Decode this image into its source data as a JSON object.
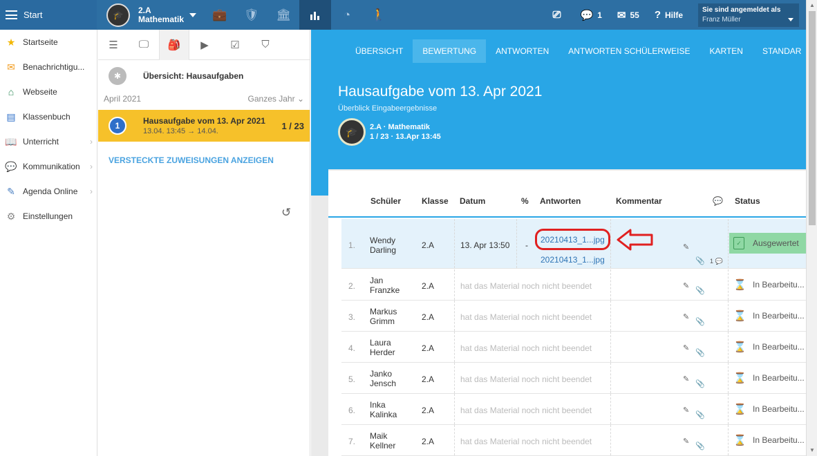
{
  "topbar": {
    "start_label": "Start",
    "class_line1": "2.A",
    "class_line2": "Mathematik",
    "messages_count": "1",
    "mail_count": "55",
    "help_label": "Hilfe",
    "login_label": "Sie sind angemeldet als",
    "login_user": "Franz Müller"
  },
  "sidebar": {
    "items": [
      {
        "label": "Startseite"
      },
      {
        "label": "Benachrichtigu..."
      },
      {
        "label": "Webseite"
      },
      {
        "label": "Klassenbuch"
      },
      {
        "label": "Unterricht"
      },
      {
        "label": "Kommunikation"
      },
      {
        "label": "Agenda Online"
      },
      {
        "label": "Einstellungen"
      }
    ]
  },
  "midpanel": {
    "overview_title": "Übersicht: Hausaufgaben",
    "period_label": "April 2021",
    "period_filter": "Ganzes Jahr",
    "assignment": {
      "number": "1",
      "title": "Hausaufgabe vom 13. Apr 2021",
      "dates": "13.04. 13:45 → 14.04.",
      "count": "1 / 23"
    },
    "hidden_link": "VERSTECKTE ZUWEISUNGEN ANZEIGEN"
  },
  "main": {
    "tabs": [
      {
        "label": "ÜBERSICHT"
      },
      {
        "label": "BEWERTUNG"
      },
      {
        "label": "ANTWORTEN"
      },
      {
        "label": "ANTWORTEN SCHÜLERWEISE"
      },
      {
        "label": "KARTEN"
      },
      {
        "label": "STANDAR"
      }
    ],
    "title": "Hausaufgabe vom 13. Apr 2021",
    "subtitle": "Überblick Eingabeergebnisse",
    "class_name": "2.A · Mathematik",
    "class_meta": "1 / 23 · 13.Apr 13:45"
  },
  "table": {
    "headers": {
      "student": "Schüler",
      "class": "Klasse",
      "date": "Datum",
      "percent": "%",
      "answers": "Antworten",
      "comment": "Kommentar",
      "status": "Status"
    },
    "selected_row": {
      "num": "1.",
      "name_line1": "Wendy",
      "name_line2": "Darling",
      "class": "2.A",
      "date": "13. Apr 13:50",
      "percent": "-",
      "file1": "20210413_1...jpg",
      "file2": "20210413_1...jpg",
      "comment_count": "1",
      "status": "Ausgewertet"
    },
    "rows": [
      {
        "num": "2.",
        "name_line1": "Jan",
        "name_line2": "Franzke",
        "class": "2.A",
        "msg": "hat das Material noch nicht beendet",
        "status": "In Bearbeitu..."
      },
      {
        "num": "3.",
        "name_line1": "Markus",
        "name_line2": "Grimm",
        "class": "2.A",
        "msg": "hat das Material noch nicht beendet",
        "status": "In Bearbeitu..."
      },
      {
        "num": "4.",
        "name_line1": "Laura",
        "name_line2": "Herder",
        "class": "2.A",
        "msg": "hat das Material noch nicht beendet",
        "status": "In Bearbeitu..."
      },
      {
        "num": "5.",
        "name_line1": "Janko",
        "name_line2": "Jensch",
        "class": "2.A",
        "msg": "hat das Material noch nicht beendet",
        "status": "In Bearbeitu..."
      },
      {
        "num": "6.",
        "name_line1": "Inka",
        "name_line2": "Kalinka",
        "class": "2.A",
        "msg": "hat das Material noch nicht beendet",
        "status": "In Bearbeitu..."
      },
      {
        "num": "7.",
        "name_line1": "Maik",
        "name_line2": "Kellner",
        "class": "2.A",
        "msg": "hat das Material noch nicht beendet",
        "status": "In Bearbeitu..."
      }
    ]
  },
  "colors": {
    "topbar": "#2d6fa3",
    "accent": "#29a6e6",
    "highlight": "#f6c12a",
    "status_done": "#8fd8a4",
    "annotation_red": "#e02020"
  }
}
